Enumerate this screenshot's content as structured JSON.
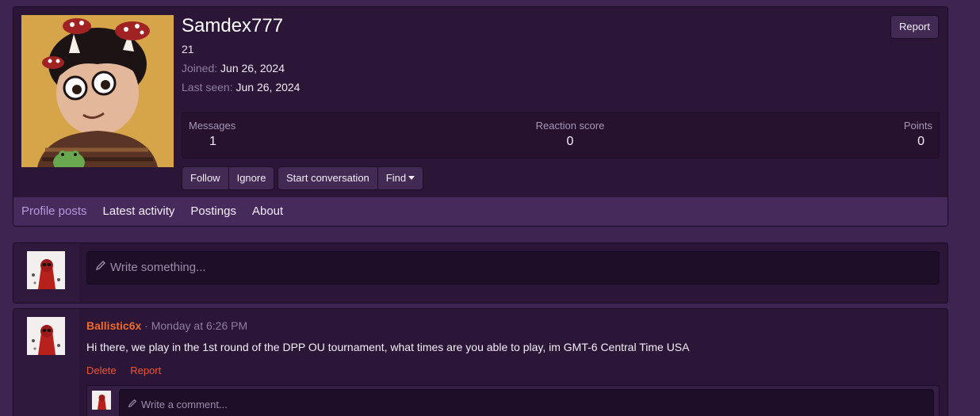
{
  "profile": {
    "username": "Samdex777",
    "user_title": "21",
    "joined_label": "Joined:",
    "joined_value": "Jun 26, 2024",
    "last_seen_label": "Last seen:",
    "last_seen_value": "Jun 26, 2024",
    "report_label": "Report",
    "stats": {
      "messages_label": "Messages",
      "messages_value": "1",
      "reaction_label": "Reaction score",
      "reaction_value": "0",
      "points_label": "Points",
      "points_value": "0"
    },
    "buttons": {
      "follow": "Follow",
      "ignore": "Ignore",
      "start_conversation": "Start conversation",
      "find": "Find"
    },
    "tabs": [
      {
        "label": "Profile posts",
        "active": true
      },
      {
        "label": "Latest activity",
        "active": false
      },
      {
        "label": "Postings",
        "active": false
      },
      {
        "label": "About",
        "active": false
      }
    ]
  },
  "composer": {
    "placeholder": "Write something..."
  },
  "post": {
    "author": "Ballistic6x",
    "separator": "·",
    "time": "Monday at 6:26 PM",
    "body": "Hi there, we play in the 1st round of the DPP OU tournament, what times are you able to play, im GMT-6 Central Time USA",
    "actions": {
      "delete": "Delete",
      "report": "Report"
    },
    "comment_placeholder": "Write a comment..."
  },
  "colors": {
    "page_bg": "#3e2450",
    "block_bg": "#2b1638",
    "tab_bar_bg": "#462a5c",
    "active_tab": "#b59bdc",
    "author_color": "#f06a2a",
    "action_color": "#f0562f"
  },
  "icons": {
    "pencil": "pencil-icon",
    "caret": "caret-down-icon"
  }
}
